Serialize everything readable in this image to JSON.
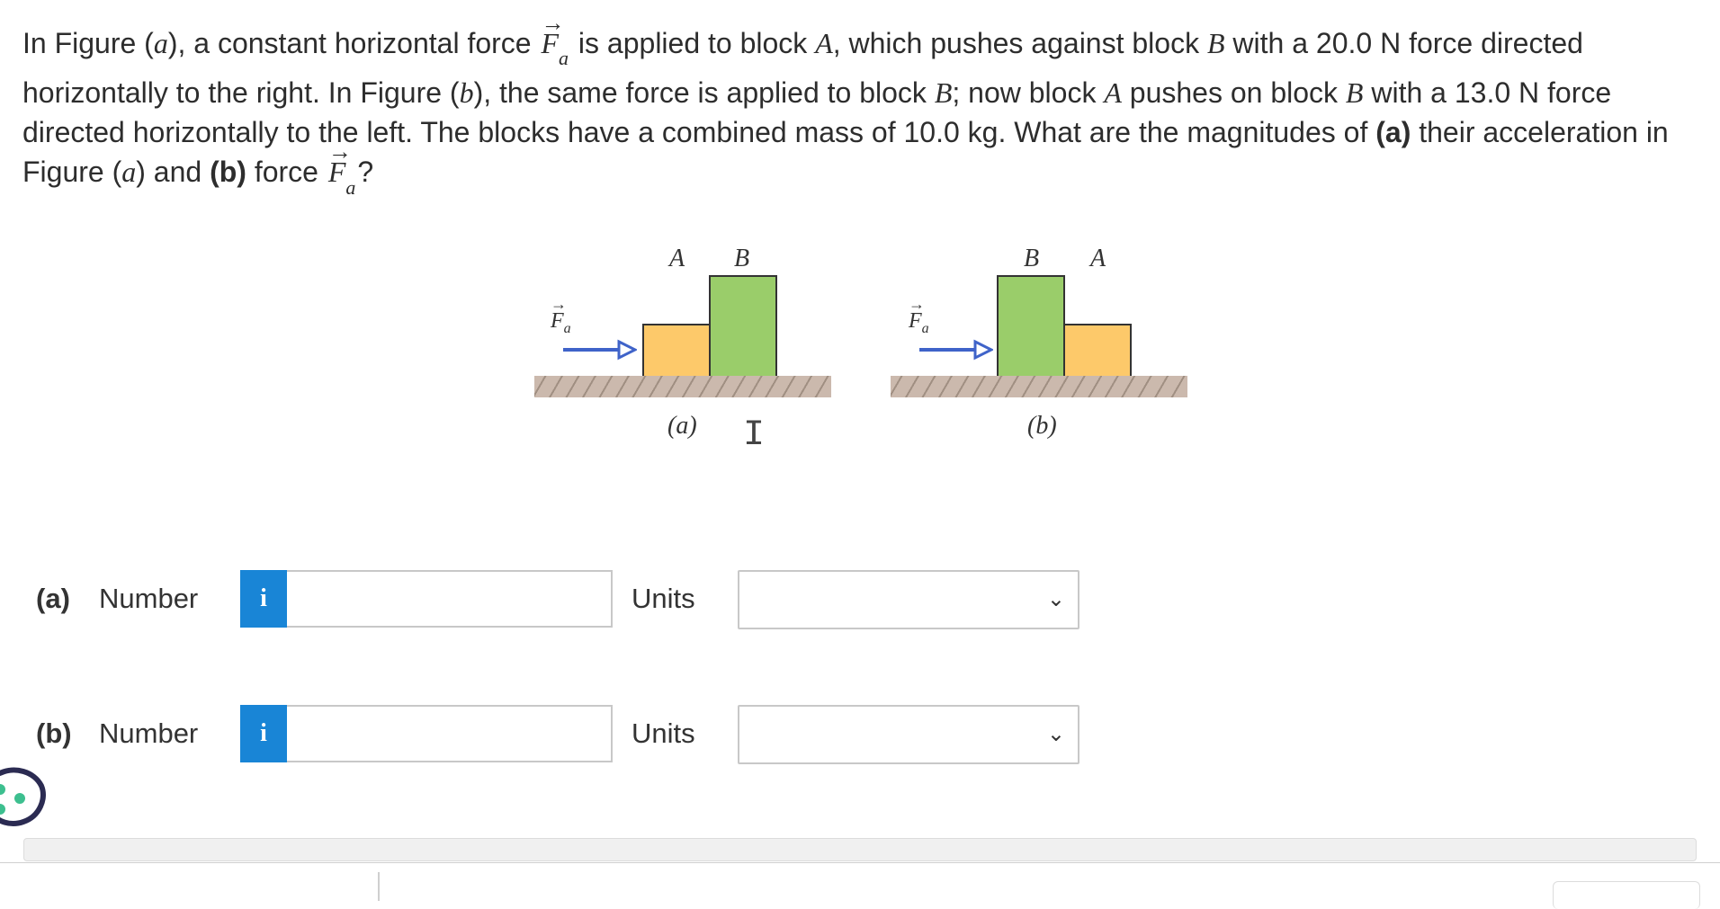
{
  "question": {
    "p1": "In Figure (",
    "p1_fig": "a",
    "p2": "), a constant horizontal force ",
    "force_symbol": "F",
    "force_sub": "a",
    "p3": " is applied to block ",
    "block_a": "A",
    "p4": ", which pushes against block ",
    "block_b": "B",
    "p5": " with a 20.0 N force directed horizontally to the right. In Figure (",
    "p5_fig": "b",
    "p6": "), the same force is applied to block ",
    "p6_block": "B",
    "p7": "; now block ",
    "p7_block": "A",
    "p8": " pushes on block ",
    "p8_block": "B",
    "p9": " with a 13.0 N force directed horizontally to the left. The blocks have a combined mass of 10.0 kg. What are the magnitudes of ",
    "part_a_bold": "(a)",
    "p10": " their acceleration in Figure (",
    "p10_fig": "a",
    "p11": ") and ",
    "part_b_bold": "(b)",
    "p12": " force ",
    "p13": "?"
  },
  "figure": {
    "label_a": "(a)",
    "label_b": "(b)",
    "block_a": "A",
    "block_b": "B",
    "force_label": "F",
    "force_sub": "a",
    "colors": {
      "block_a": "#fdc96a",
      "block_b": "#9acd6a",
      "arrow": "#3f63c9",
      "ground": "#cbb9ad"
    }
  },
  "answers": [
    {
      "part": "(a)",
      "number_label": "Number",
      "info_icon": "i",
      "value": "",
      "units_label": "Units",
      "units_value": ""
    },
    {
      "part": "(b)",
      "number_label": "Number",
      "info_icon": "i",
      "value": "",
      "units_label": "Units",
      "units_value": ""
    }
  ],
  "colors": {
    "info_button": "#1985d6",
    "text": "#2d2d2d"
  }
}
